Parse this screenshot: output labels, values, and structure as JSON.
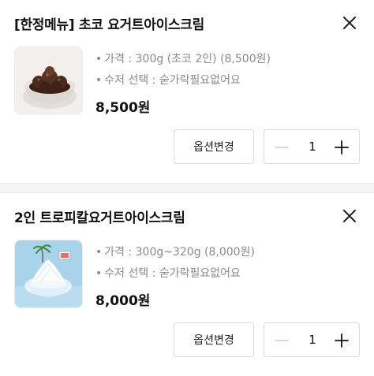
{
  "cart_items": [
    {
      "title": "[한정메뉴] 초코 요거트아이스크림",
      "price_option": "가격 : 300g (초코 2인) (8,500원)",
      "utensil_option": "수저 선택 : 숟가락필요없어요",
      "price": "8,500원",
      "option_change_label": "옵션변경",
      "quantity": "1",
      "image_icon": "chocolate-yogurt-ice-cream-photo"
    },
    {
      "title": "2인 트로피칼요거트아이스크림",
      "price_option": "가격 : 300g~320g (8,000원)",
      "utensil_option": "수저 선택 : 숟가락필요없어요",
      "price": "8,000원",
      "option_change_label": "옵션변경",
      "quantity": "1",
      "image_icon": "tropical-yogurt-ice-cream-photo"
    }
  ],
  "bullet": "•",
  "icons": {
    "close": "close-icon",
    "minus": "minus-icon",
    "plus": "plus-icon"
  },
  "colors": {
    "text_primary": "#111111",
    "text_secondary": "#8a8a8a",
    "border": "#dddddd",
    "divider_bg": "#f4f4f5",
    "stepper_minus_disabled": "#cccccc"
  }
}
